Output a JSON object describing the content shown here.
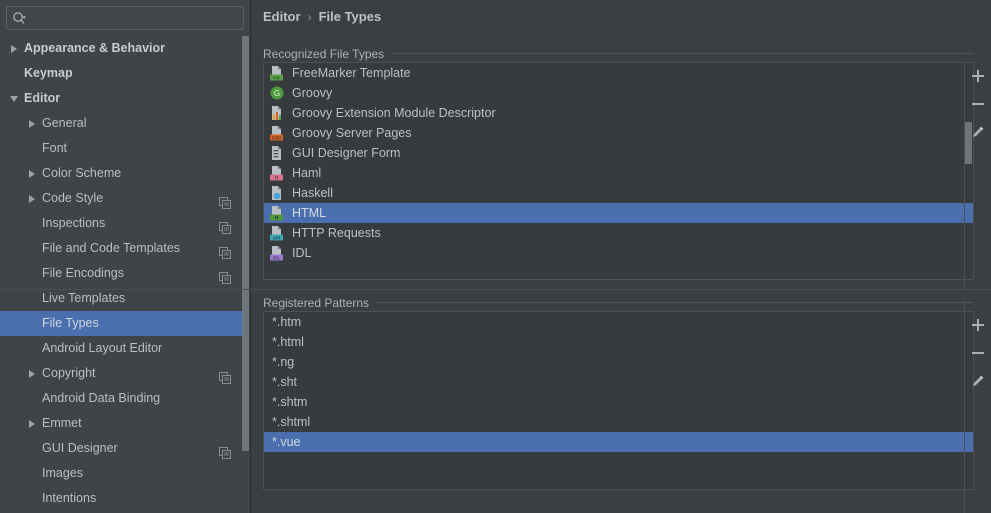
{
  "window": {
    "bg": "#3c3f41",
    "accent": "#4b6eaf"
  },
  "search": {
    "placeholder": "",
    "value": "",
    "icon": "search-icon",
    "dropdown_icon": "chevron-down-icon"
  },
  "sidebar": {
    "items": [
      {
        "label": "Appearance & Behavior",
        "level": 0,
        "twisty": "collapsed",
        "bold": true,
        "selected": false,
        "copy": false
      },
      {
        "label": "Keymap",
        "level": 0,
        "twisty": "none",
        "bold": true,
        "selected": false,
        "copy": false
      },
      {
        "label": "Editor",
        "level": 0,
        "twisty": "expanded",
        "bold": true,
        "selected": false,
        "copy": false
      },
      {
        "label": "General",
        "level": 1,
        "twisty": "collapsed",
        "bold": false,
        "selected": false,
        "copy": false
      },
      {
        "label": "Font",
        "level": 1,
        "twisty": "none",
        "bold": false,
        "selected": false,
        "copy": false
      },
      {
        "label": "Color Scheme",
        "level": 1,
        "twisty": "collapsed",
        "bold": false,
        "selected": false,
        "copy": false
      },
      {
        "label": "Code Style",
        "level": 1,
        "twisty": "collapsed",
        "bold": false,
        "selected": false,
        "copy": true
      },
      {
        "label": "Inspections",
        "level": 1,
        "twisty": "none",
        "bold": false,
        "selected": false,
        "copy": true
      },
      {
        "label": "File and Code Templates",
        "level": 1,
        "twisty": "none",
        "bold": false,
        "selected": false,
        "copy": true
      },
      {
        "label": "File Encodings",
        "level": 1,
        "twisty": "none",
        "bold": false,
        "selected": false,
        "copy": true
      },
      {
        "label": "Live Templates",
        "level": 1,
        "twisty": "none",
        "bold": false,
        "selected": false,
        "copy": false
      },
      {
        "label": "File Types",
        "level": 1,
        "twisty": "none",
        "bold": false,
        "selected": true,
        "copy": false
      },
      {
        "label": "Android Layout Editor",
        "level": 1,
        "twisty": "none",
        "bold": false,
        "selected": false,
        "copy": false
      },
      {
        "label": "Copyright",
        "level": 1,
        "twisty": "collapsed",
        "bold": false,
        "selected": false,
        "copy": true
      },
      {
        "label": "Android Data Binding",
        "level": 1,
        "twisty": "none",
        "bold": false,
        "selected": false,
        "copy": false
      },
      {
        "label": "Emmet",
        "level": 1,
        "twisty": "collapsed",
        "bold": false,
        "selected": false,
        "copy": false
      },
      {
        "label": "GUI Designer",
        "level": 1,
        "twisty": "none",
        "bold": false,
        "selected": false,
        "copy": true
      },
      {
        "label": "Images",
        "level": 1,
        "twisty": "none",
        "bold": false,
        "selected": false,
        "copy": false
      },
      {
        "label": "Intentions",
        "level": 1,
        "twisty": "none",
        "bold": false,
        "selected": false,
        "copy": false
      }
    ]
  },
  "breadcrumb": {
    "parent": "Editor",
    "separator": "›",
    "current": "File Types"
  },
  "recognized": {
    "title": "Recognized File Types",
    "items": [
      {
        "label": "FreeMarker Template",
        "icon": "file-freemarker-icon",
        "badge": "<>",
        "badge_bg": "#5a9e4a",
        "selected": false
      },
      {
        "label": "Groovy",
        "icon": "groovy-circle-icon",
        "badge": "G",
        "badge_bg": "#4f9b3c",
        "selected": false
      },
      {
        "label": "Groovy Extension Module Descriptor",
        "icon": "file-chart-icon",
        "badge": "",
        "badge_bg": "#e08b2a",
        "selected": false
      },
      {
        "label": "Groovy Server Pages",
        "icon": "file-gsp-icon",
        "badge": "GSP",
        "badge_bg": "#d4622a",
        "selected": false
      },
      {
        "label": "GUI Designer Form",
        "icon": "file-form-icon",
        "badge": "",
        "badge_bg": "#9aa0a6",
        "selected": false
      },
      {
        "label": "Haml",
        "icon": "file-haml-icon",
        "badge": "h",
        "badge_bg": "#d4738b",
        "selected": false
      },
      {
        "label": "Haskell",
        "icon": "haskell-icon",
        "badge": "",
        "badge_bg": "#4aa3d8",
        "selected": false
      },
      {
        "label": "HTML",
        "icon": "file-html-icon",
        "badge": "H",
        "badge_bg": "#4f9b3c",
        "selected": true
      },
      {
        "label": "HTTP Requests",
        "icon": "file-api-icon",
        "badge": "API",
        "badge_bg": "#3fa5b5",
        "selected": false
      },
      {
        "label": "IDL",
        "icon": "file-idl-icon",
        "badge": "IDL",
        "badge_bg": "#9b7ad1",
        "selected": false
      }
    ],
    "buttons": [
      {
        "label": "+",
        "name": "add-file-type-button"
      },
      {
        "label": "−",
        "name": "remove-file-type-button"
      },
      {
        "label": "✎",
        "name": "edit-file-type-button"
      }
    ]
  },
  "patterns": {
    "title": "Registered Patterns",
    "items": [
      {
        "label": "*.htm",
        "selected": false
      },
      {
        "label": "*.html",
        "selected": false
      },
      {
        "label": "*.ng",
        "selected": false
      },
      {
        "label": "*.sht",
        "selected": false
      },
      {
        "label": "*.shtm",
        "selected": false
      },
      {
        "label": "*.shtml",
        "selected": false
      },
      {
        "label": "*.vue",
        "selected": true
      }
    ],
    "buttons": [
      {
        "label": "+",
        "name": "add-pattern-button"
      },
      {
        "label": "−",
        "name": "remove-pattern-button"
      },
      {
        "label": "✎",
        "name": "edit-pattern-button"
      }
    ]
  }
}
